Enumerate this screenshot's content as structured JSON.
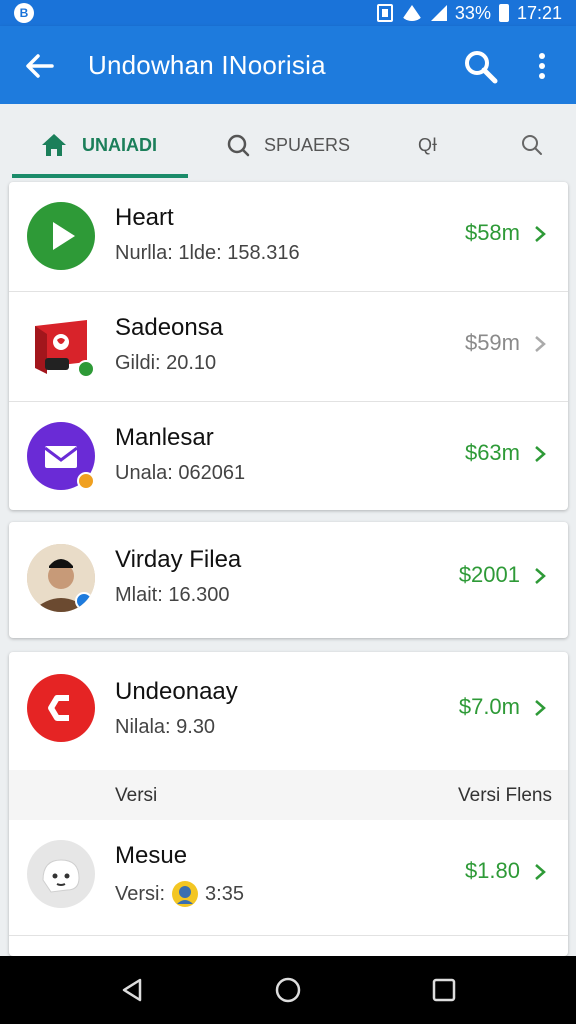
{
  "status_bar": {
    "left_icon_text": "B",
    "battery": "33%",
    "time": "17:21"
  },
  "app_bar": {
    "title": "Undowhan INoorisia"
  },
  "tabs": [
    {
      "label": "UNAIADI",
      "icon": "home-icon"
    },
    {
      "label": "SPUAERS",
      "icon": "search-icon"
    },
    {
      "label": "QƗ",
      "icon": ""
    },
    {
      "label": "",
      "icon": "search-icon"
    }
  ],
  "items": [
    {
      "name": "Heart",
      "sub": "Nurlla: 1lde: 158.316",
      "price": "$58m",
      "icon": "play-icon",
      "color": "#2e9a37"
    },
    {
      "name": "Sadeonsa",
      "sub": "Gildi: 20.10",
      "price": "$59m",
      "icon": "red-box-icon",
      "color": "#d8232a"
    },
    {
      "name": "Manlesar",
      "sub": "Unala: 062061",
      "price": "$63m",
      "icon": "mail-icon",
      "color": "#6a2bd6"
    },
    {
      "name": "Virday Filea",
      "sub": "Mlait: 16.300",
      "price": "$2001",
      "icon": "person-avatar",
      "color": "#b5967a"
    },
    {
      "name": "Undeonaay",
      "sub": "Nilala: 9.30",
      "price": "$7.0m",
      "icon": "brand-c-icon",
      "color": "#e52424"
    },
    {
      "name": "Mesue",
      "sub": "Versi:",
      "sub_time": "3:35",
      "price": "$1.80",
      "icon": "ghost-icon",
      "color": "#e0e0e0"
    }
  ],
  "section_header": {
    "left": "Versi",
    "right": "Versi Flens"
  },
  "colors": {
    "primary": "#1e7bdd",
    "accent_green": "#2e9a37",
    "tab_active": "#1b7f5a"
  }
}
